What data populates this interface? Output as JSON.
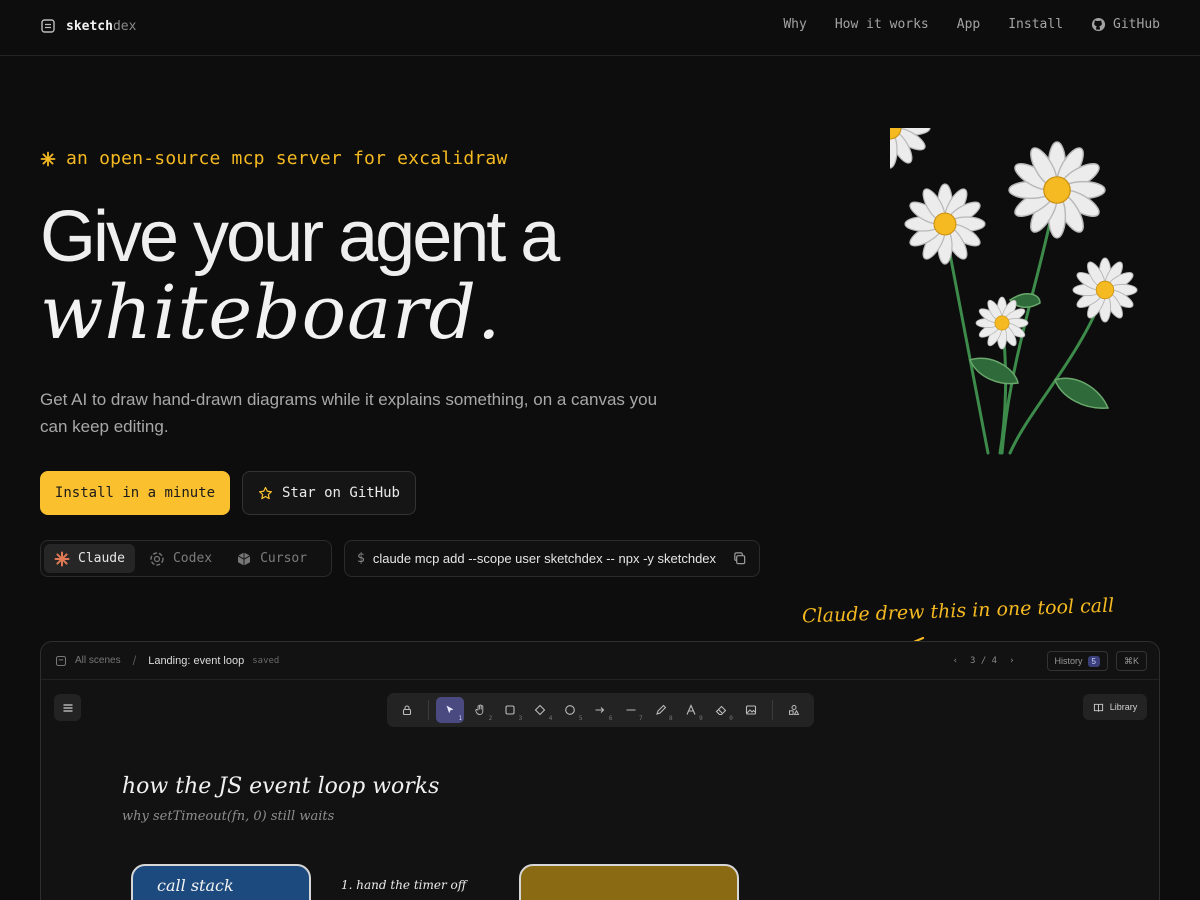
{
  "nav": {
    "brand_a": "sketch",
    "brand_b": "dex",
    "links": [
      "Why",
      "How it works",
      "App",
      "Install",
      "GitHub"
    ]
  },
  "hero": {
    "kicker": "an open-source mcp server for excalidraw",
    "title_line1": "Give your agent a",
    "title_line2": "whiteboard.",
    "lede": "Get AI to draw hand-drawn diagrams while it explains something, on a canvas you can keep editing.",
    "cta_primary": "Install in a minute",
    "cta_secondary": "Star on GitHub"
  },
  "install": {
    "tabs": [
      {
        "label": "Claude",
        "icon": "claude-icon",
        "active": true
      },
      {
        "label": "Codex",
        "icon": "codex-icon",
        "active": false
      },
      {
        "label": "Cursor",
        "icon": "cursor-icon",
        "active": false
      }
    ],
    "prompt": "$",
    "command": "claude mcp add --scope user sketchdex -- npx -y sketchdex"
  },
  "annotation": "Claude drew this in one tool call",
  "app": {
    "crumb_root": "All scenes",
    "crumb_sep": "/",
    "scene_title": "Landing: event loop",
    "saved": "saved",
    "pager_prev": "‹",
    "pager": "3 / 4",
    "pager_next": "›",
    "history_label": "History",
    "history_count": "5",
    "shortcut": "⌘K",
    "library": "Library",
    "tool_numbers": [
      "1",
      "2",
      "3",
      "4",
      "5",
      "6",
      "7",
      "8",
      "9",
      "0"
    ],
    "canvas": {
      "title": "how the JS event loop works",
      "subtitle": "why setTimeout(fn, 0) still waits",
      "box1_label": "call stack",
      "step1": "1. hand the timer off"
    }
  },
  "colors": {
    "accent": "#fbc02d",
    "background": "#0d0d0d",
    "stack_box": "#1d4a7e",
    "api_box": "#8a6a12"
  }
}
